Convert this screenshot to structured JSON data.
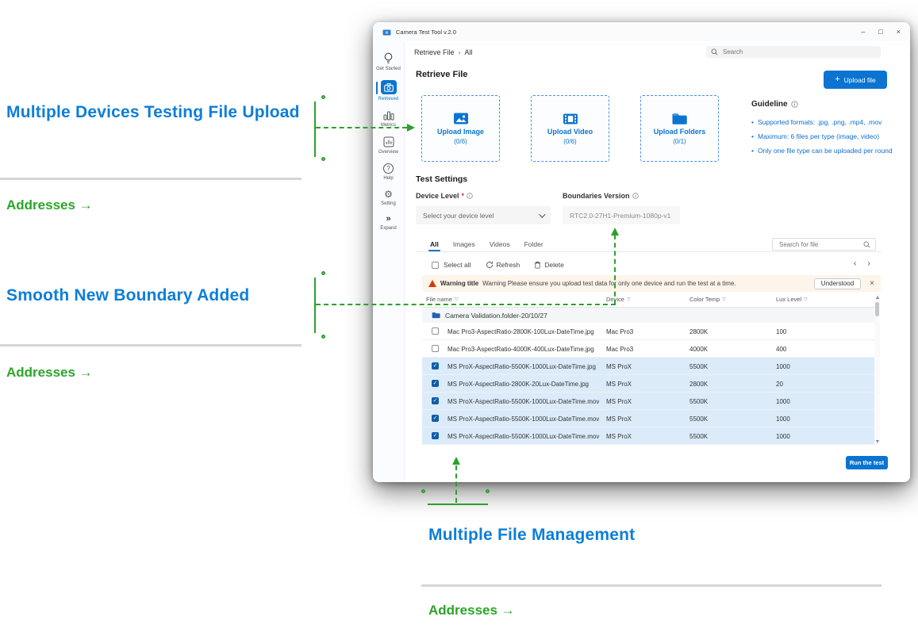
{
  "colors": {
    "accent_blue": "#0B74D1",
    "annotation_blue": "#0D7ED8",
    "annotation_green": "#2CA02C",
    "selected_row_bg": "#DCEBFA",
    "warning_bg": "#FDF4EA",
    "warning_icon": "#D83B01"
  },
  "annotations": {
    "callout1": "Multiple Devices Testing File Upload",
    "callout1_link": "Addresses →",
    "callout2": "Smooth New Boundary Added",
    "callout2_link": "Addresses →",
    "callout3": "Multiple File Management",
    "callout3_link": "Addresses →"
  },
  "window": {
    "title": "Camera Test Tool v.2.0",
    "controls": {
      "minimize": "–",
      "maximize": "□",
      "close": "×"
    }
  },
  "header": {
    "breadcrumb": {
      "level1": "Retrieve File",
      "separator": "›",
      "level2": "All"
    },
    "search_placeholder": "Search"
  },
  "sidebar": {
    "items": [
      {
        "label": "Get Started"
      },
      {
        "label": "Retrieved"
      },
      {
        "label": "Metrics"
      },
      {
        "label": "Overview"
      },
      {
        "label": "Help"
      },
      {
        "label": "Setting"
      },
      {
        "label": "Expand"
      }
    ]
  },
  "icons": {
    "plus": "+",
    "help": "?",
    "gear": "⚙",
    "expand": "»",
    "prev": "‹",
    "next": "›",
    "check": "✓",
    "filter": "▽",
    "close": "×",
    "required": "*"
  },
  "main": {
    "page_title": "Retrieve File",
    "upload_button": "Upload file",
    "cards": [
      {
        "label": "Upload Image",
        "count": "(0/6)"
      },
      {
        "label": "Upload Video",
        "count": "(0/6)"
      },
      {
        "label": "Upload Folders",
        "count": "(0/1)"
      }
    ],
    "guideline": {
      "title": "Guideline",
      "bullets": [
        "Supported formats: .jpg, .png, .mp4, .mov",
        "Maximum: 6 files per type (image, video)",
        "Only one file type can be uploaded per round"
      ]
    },
    "test_settings": {
      "title": "Test Settings",
      "device_label": "Device Level",
      "device_value": "Select your device level",
      "boundaries_label": "Boundaries Version",
      "boundaries_value": "RTC2.0-27H1-Premium-1080p-v1"
    },
    "tabs": [
      "All",
      "Images",
      "Videos",
      "Folder"
    ],
    "file_search_placeholder": "Search for file",
    "toolbar": {
      "select_all": "Select all",
      "refresh": "Refresh",
      "delete": "Delete"
    },
    "warning": {
      "title": "Warning title",
      "message": "Warning  Please ensure you upload test data for only one device and run the test at a time.",
      "action": "Understood"
    },
    "table": {
      "columns": [
        "File name",
        "Device",
        "Color Temp",
        "Lux Level"
      ],
      "folder_row": "Camera Validation.folder-20/10/27",
      "rows": [
        {
          "name": "Mac Pro3-AspectRatio-2800K-100Lux-DateTime.jpg",
          "device": "Mac Pro3",
          "temp": "2800K",
          "lux": "100",
          "checked": false
        },
        {
          "name": "Mac Pro3-AspectRatio-4000K-400Lux-DateTime.jpg",
          "device": "Mac Pro3",
          "temp": "4000K",
          "lux": "400",
          "checked": false
        },
        {
          "name": "MS ProX-AspectRatio-5500K-1000Lux-DateTime.jpg",
          "device": "MS ProX",
          "temp": "5500K",
          "lux": "1000",
          "checked": true
        },
        {
          "name": "MS ProX-AspectRatio-2800K-20Lux-DateTime.jpg",
          "device": "MS ProX",
          "temp": "2800K",
          "lux": "20",
          "checked": true
        },
        {
          "name": "MS ProX-AspectRatio-5500K-1000Lux-DateTime.mov",
          "device": "MS ProX",
          "temp": "5500K",
          "lux": "1000",
          "checked": true
        },
        {
          "name": "MS ProX-AspectRatio-5500K-1000Lux-DateTime.mov",
          "device": "MS ProX",
          "temp": "5500K",
          "lux": "1000",
          "checked": true
        },
        {
          "name": "MS ProX-AspectRatio-5500K-1000Lux-DateTime.mov",
          "device": "MS ProX",
          "temp": "5500K",
          "lux": "1000",
          "checked": true
        }
      ]
    },
    "run_button": "Run the test"
  }
}
